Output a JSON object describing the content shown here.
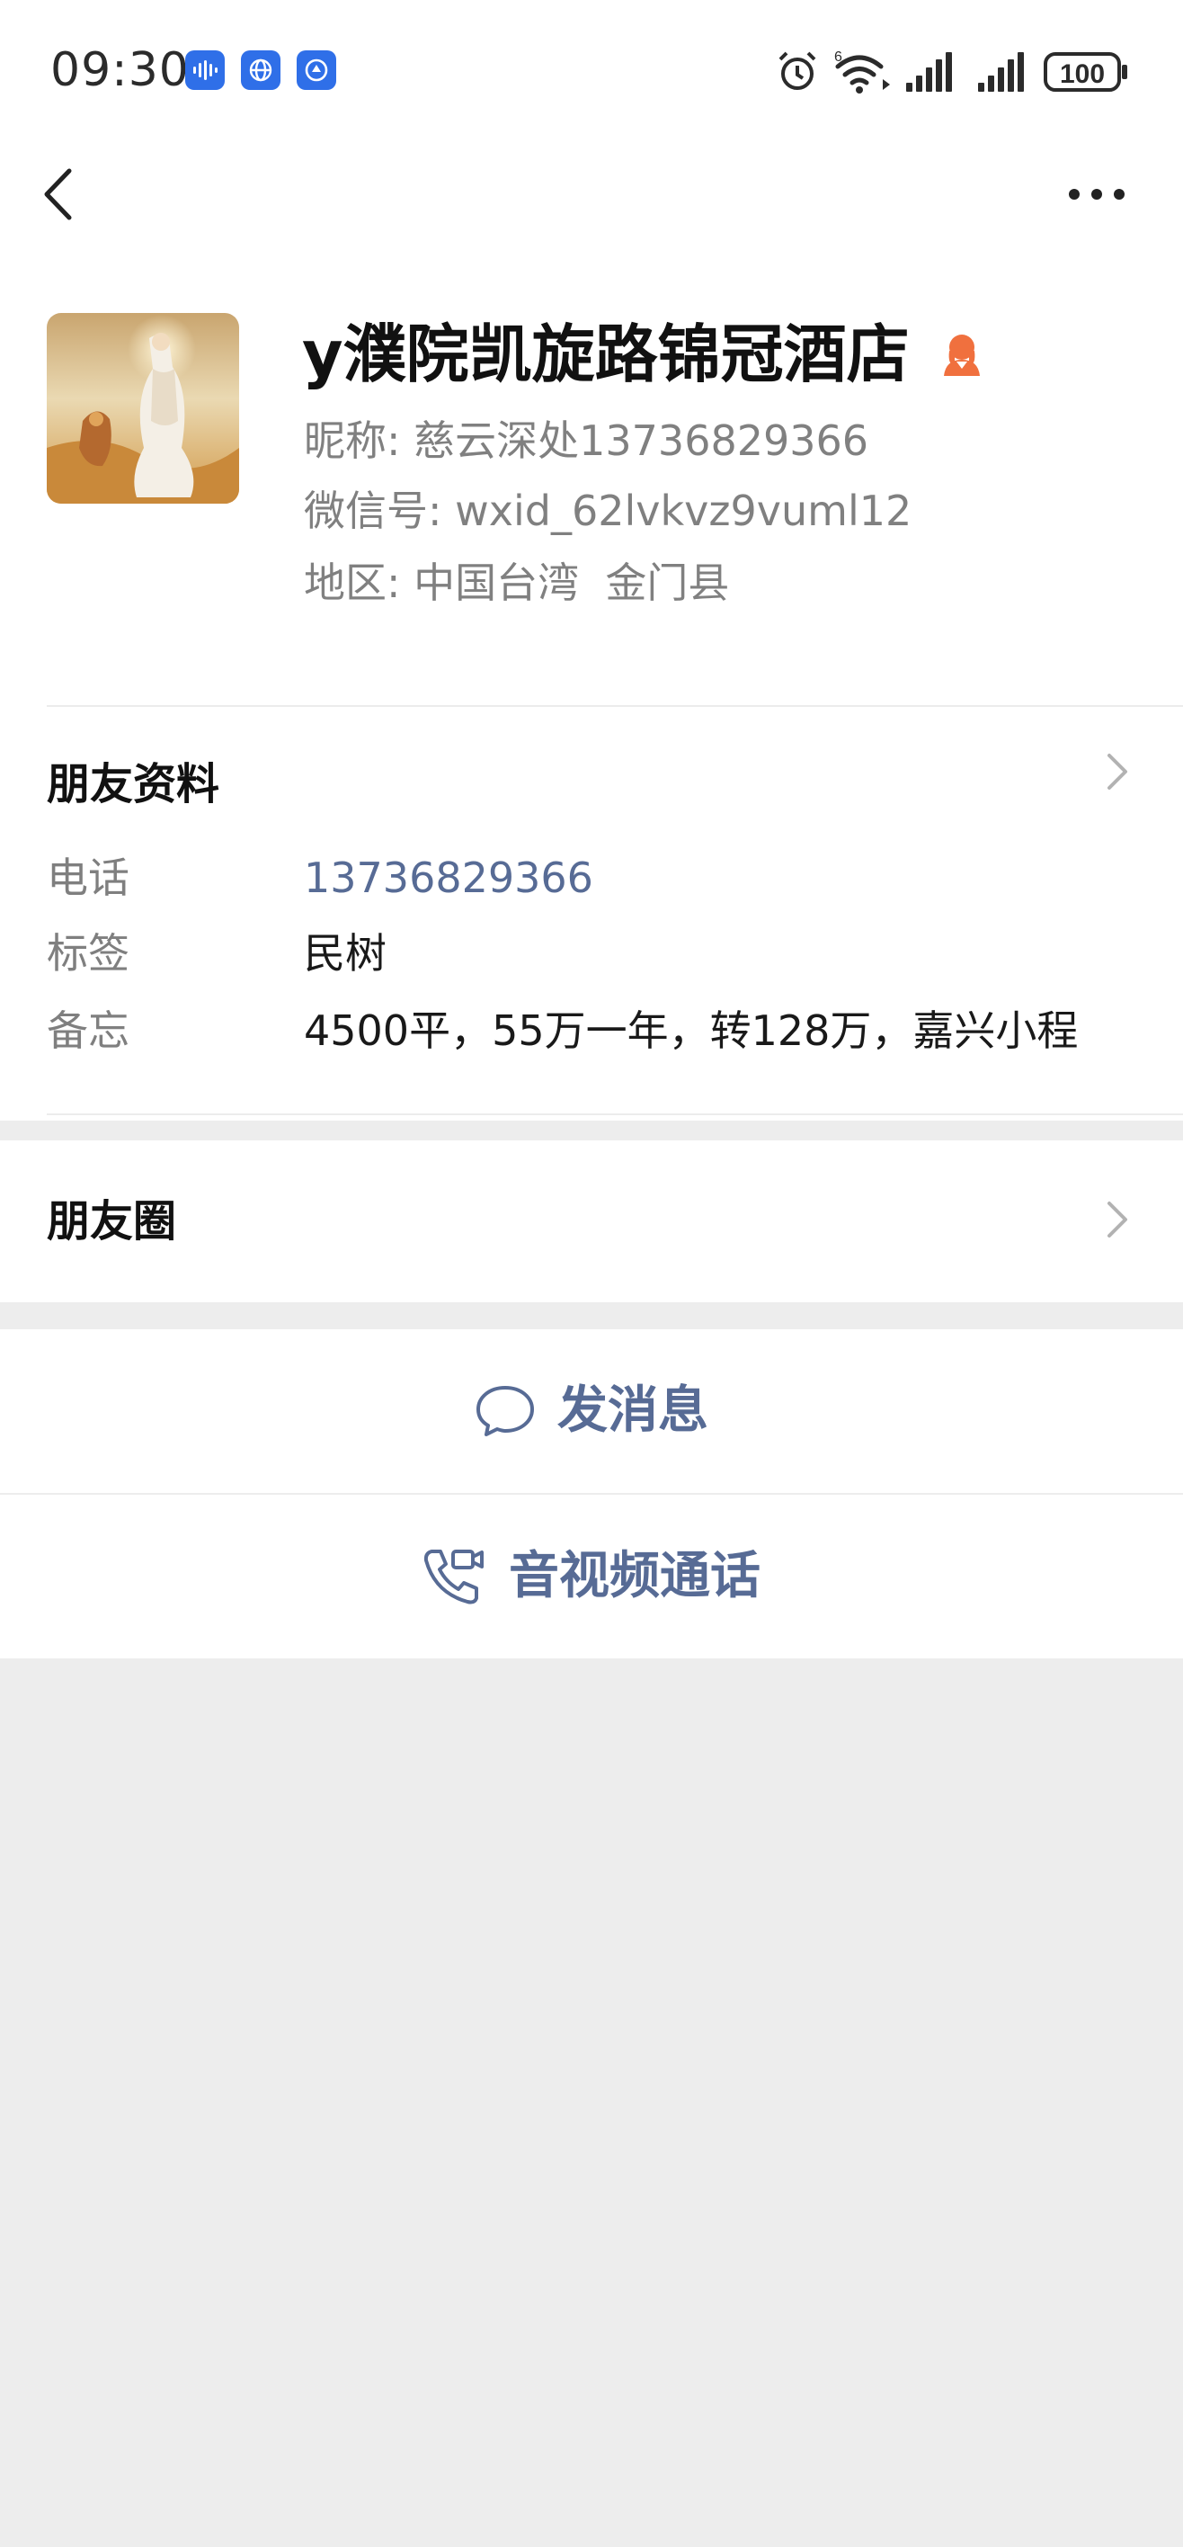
{
  "status_bar": {
    "time": "09:30",
    "wifi_label": "6",
    "battery": "100"
  },
  "nav": {
    "back_icon": "chevron-left-icon",
    "more_icon": "more-horizontal-icon"
  },
  "profile": {
    "name": "y濮院凯旋路锦冠酒店",
    "nickname_label": "昵称:",
    "nickname": "慈云深处13736829366",
    "wechat_id_label": "微信号:",
    "wechat_id": "wxid_62lvkvz9vuml12",
    "region_label": "地区:",
    "region": "中国台湾  金门县",
    "gender_icon": "female-user-icon",
    "gender_color": "#f0703e"
  },
  "friend_info": {
    "title": "朋友资料",
    "rows": [
      {
        "label": "电话",
        "value": "13736829366"
      },
      {
        "label": "标签",
        "value": "民树"
      },
      {
        "label": "备忘",
        "value": "4500平，55万一年，转128万，嘉兴小程"
      }
    ]
  },
  "moments": {
    "title": "朋友圈"
  },
  "actions": {
    "message": "发消息",
    "call": "音视频通话"
  },
  "colors": {
    "link": "#576b95",
    "background": "#ededed"
  }
}
